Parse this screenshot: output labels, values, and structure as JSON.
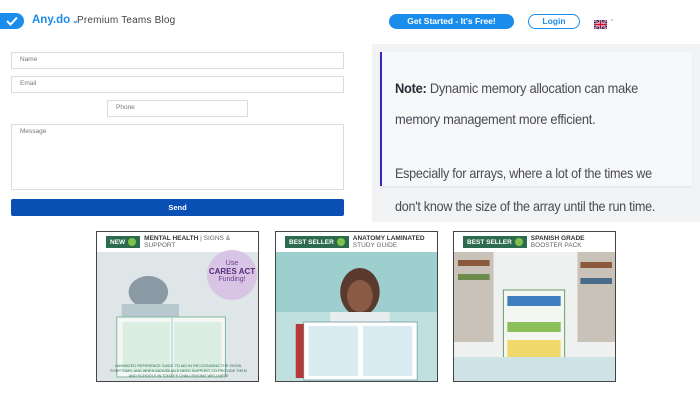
{
  "header": {
    "brand": "Any.do",
    "blog_name": "Premium Teams Blog",
    "get_started_label": "Get Started - It's Free!",
    "login_label": "Login",
    "lang_label": "⌂"
  },
  "form": {
    "name_placeholder": "Name",
    "email_placeholder": "Email",
    "phone_placeholder": "Phone",
    "message_placeholder": "Message",
    "send_label": "Send"
  },
  "note": {
    "label": "Note:",
    "text": " Dynamic memory allocation can make memory management more efficient.",
    "text2": "Especially for arrays, where a lot of the times we don't know the size of the array until the run time."
  },
  "ads": [
    {
      "ribbon": "NEW",
      "title": "MENTAL HEALTH",
      "subtitle": "SIGNS & SUPPORT",
      "bubble_line1": "Use",
      "bubble_line2": "CARES ACT",
      "bubble_line3": "Funding!",
      "caption": "LAMINATED REFERENCE GUIDE TO AID IN RECOGNIZING THE SIGNS, SYMPTOMS, AND WHEN INDIVIDUALS NEED SUPPORT, TO PROVIDE THEM AND SCHOOLS IN TODAY'S CHALLENGING WELLNESS"
    },
    {
      "ribbon": "BEST SELLER",
      "title": "ANATOMY LAMINATED",
      "subtitle": "STUDY GUIDE"
    },
    {
      "ribbon": "BEST SELLER",
      "title": "SPANISH GRADE",
      "subtitle": "BOOSTER PACK"
    }
  ],
  "colors": {
    "brand_blue": "#1a8ceb",
    "send_blue": "#0a4fb4",
    "note_border": "#3a28b8",
    "ribbon_green": "#2d6b4f"
  }
}
